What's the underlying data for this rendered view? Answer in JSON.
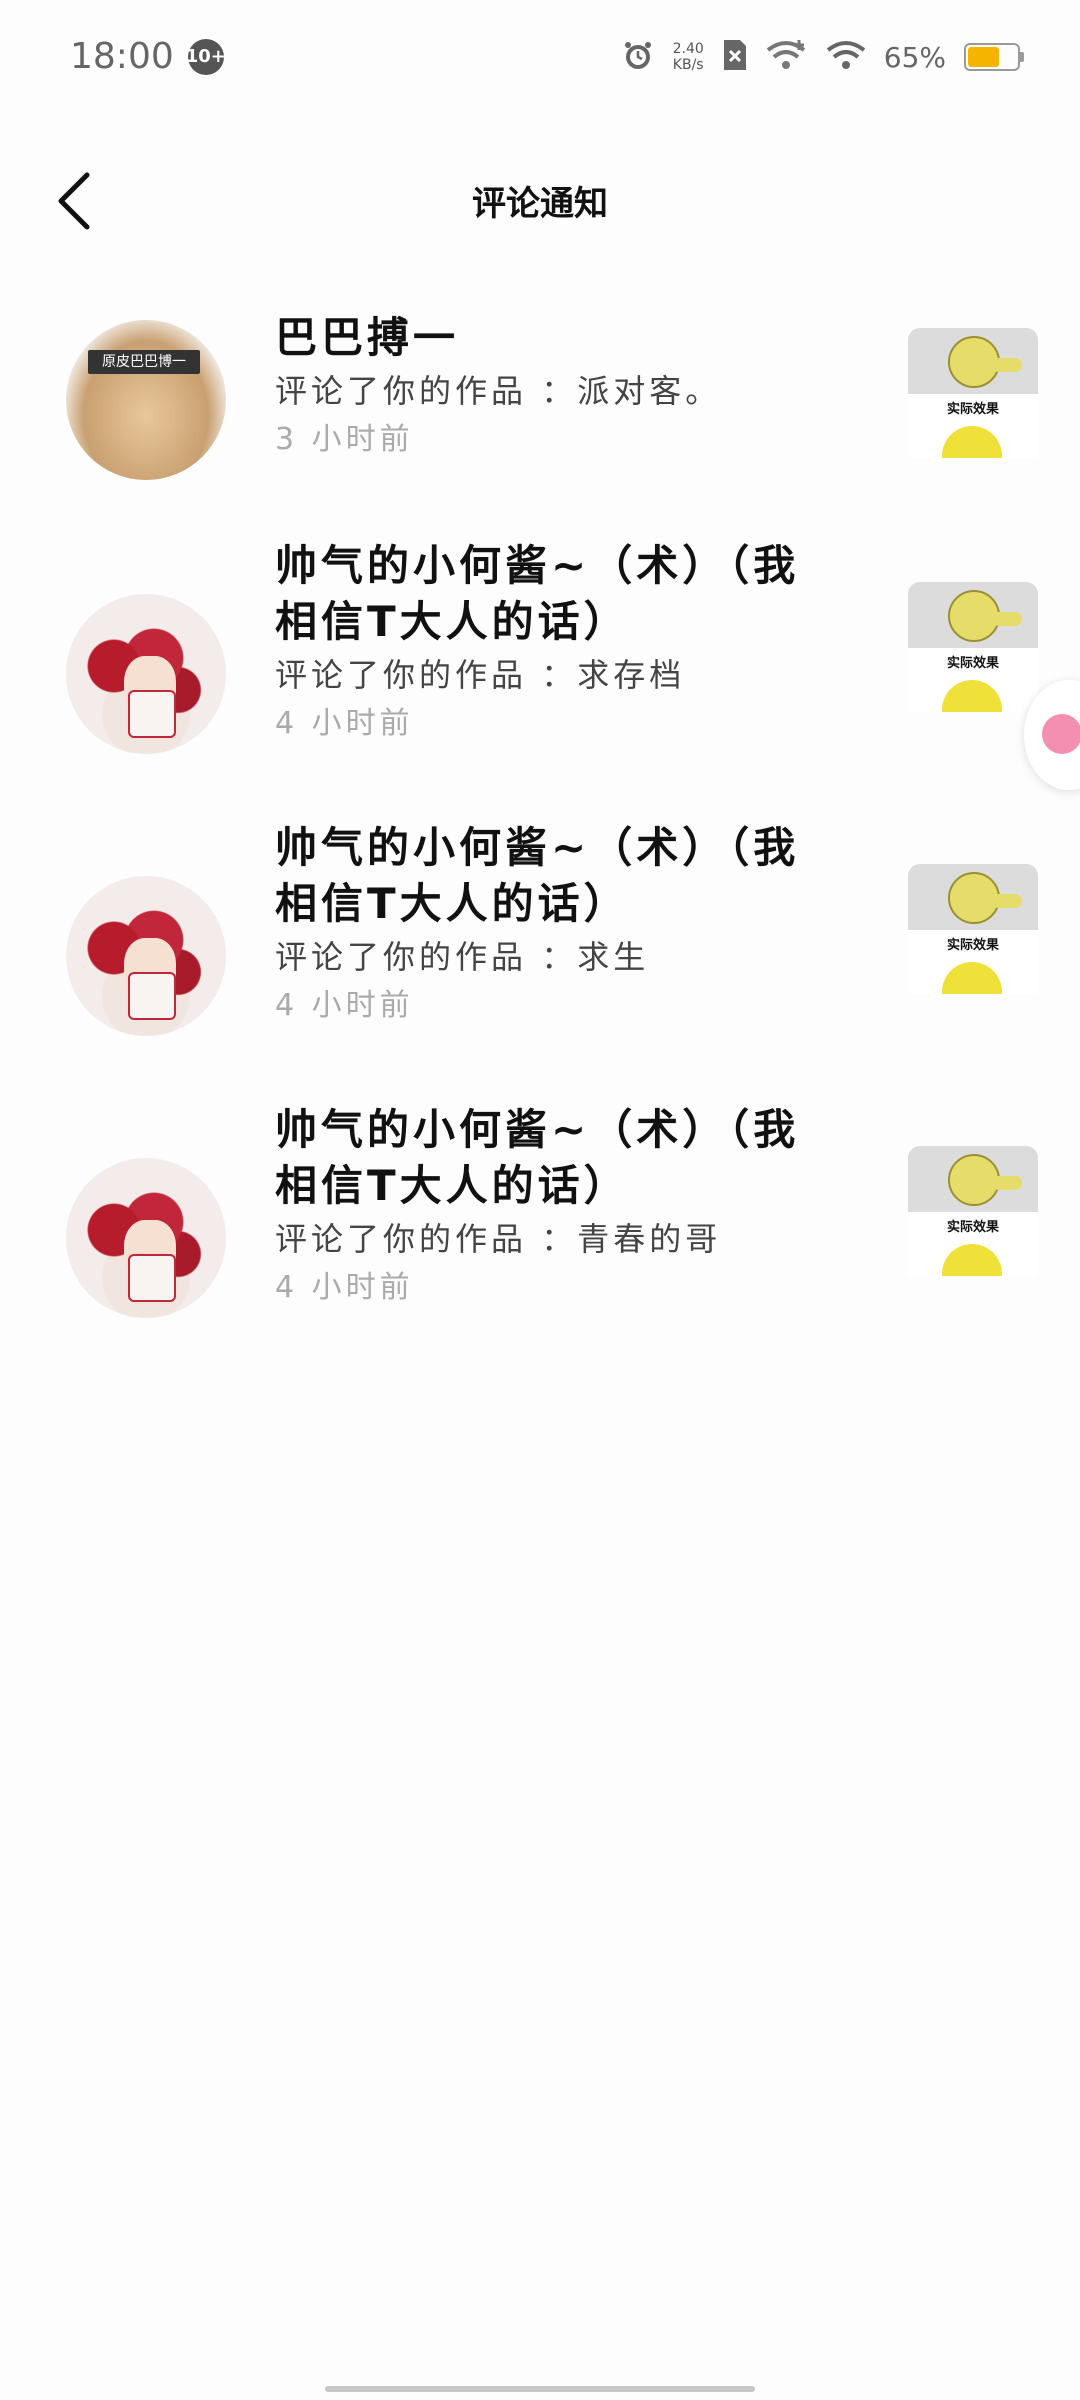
{
  "status_bar": {
    "time": "18:00",
    "badge": "10+",
    "net_speed_value": "2.40",
    "net_speed_unit": "KB/s",
    "battery_text": "65%",
    "battery_level": 0.65,
    "battery_color": "#f4b400"
  },
  "header": {
    "title": "评论通知",
    "back_icon": "chevron-left-icon"
  },
  "notifications": [
    {
      "username": "巴巴搏一",
      "action": "评论了你的作品",
      "comment": "：派对客。",
      "time": "3 小时前",
      "avatar_label": "原皮巴巴博一",
      "thumb_caption": "实际效果"
    },
    {
      "username": "帅气的小何酱~（术）（我相信T大人的话）",
      "action": "评论了你的作品",
      "comment": "：求存档",
      "time": "4 小时前",
      "thumb_caption": "实际效果"
    },
    {
      "username": "帅气的小何酱~（术）（我相信T大人的话）",
      "action": "评论了你的作品",
      "comment": "：求生",
      "time": "4 小时前",
      "thumb_caption": "实际效果"
    },
    {
      "username": "帅气的小何酱~（术）（我相信T大人的话）",
      "action": "评论了你的作品",
      "comment": "：青春的哥",
      "time": "4 小时前",
      "thumb_caption": "实际效果"
    }
  ]
}
